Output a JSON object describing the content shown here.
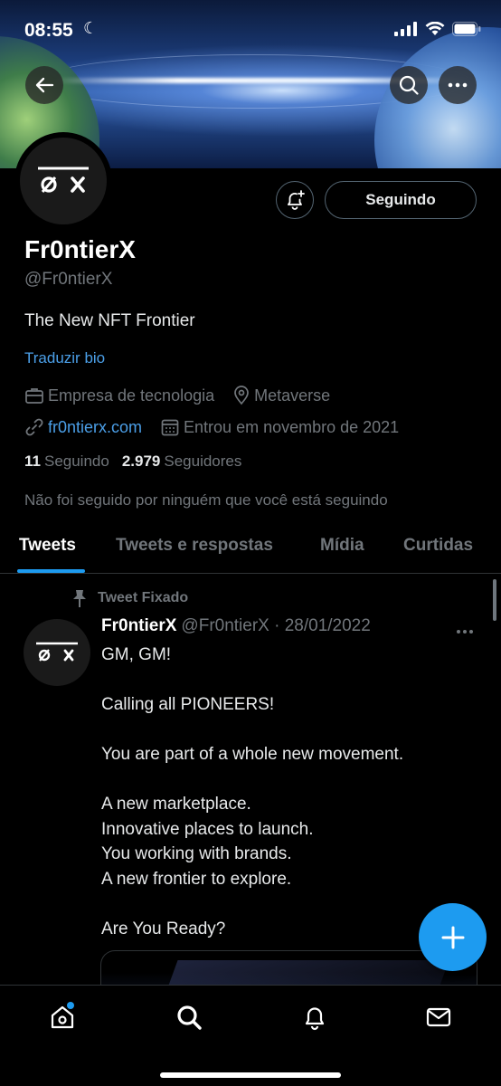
{
  "status_bar": {
    "time": "08:55"
  },
  "profile": {
    "name": "Fr0ntierX",
    "handle": "@Fr0ntierX",
    "bio": "The New NFT Frontier",
    "translate_bio": "Traduzir bio",
    "category": "Empresa de tecnologia",
    "location": "Metaverse",
    "website": "fr0ntierx.com",
    "joined": "Entrou em novembro de 2021",
    "following_count": "11",
    "following_label": "Seguindo",
    "followers_count": "2.979",
    "followers_label": "Seguidores",
    "not_followed_text": "Não foi seguido por ninguém que você está seguindo",
    "follow_button": "Seguindo",
    "avatar_text": "Ø ✕"
  },
  "tabs": [
    {
      "label": "Tweets",
      "active": true
    },
    {
      "label": "Tweets e respostas",
      "active": false
    },
    {
      "label": "Mídia",
      "active": false
    },
    {
      "label": "Curtidas",
      "active": false
    }
  ],
  "tweet": {
    "pinned_label": "Tweet Fixado",
    "author": "Fr0ntierX",
    "handle_date": "@Fr0ntierX · 28/01/2022",
    "text": "GM, GM!\n\nCalling all PIONEERS!\n\nYou are part of a whole new movement.\n\nA new marketplace.\nInnovative places to launch.\nYou working with brands.\nA new frontier to explore.\n\nAre You Ready?"
  },
  "colors": {
    "accent": "#1d9bf0",
    "link": "#4b9fe8",
    "muted": "#71767b",
    "background": "#000000"
  },
  "icons": [
    "back-arrow-icon",
    "search-icon",
    "more-icon",
    "bell-plus-icon",
    "briefcase-icon",
    "location-pin-icon",
    "link-icon",
    "calendar-icon",
    "pin-icon",
    "compose-icon",
    "home-icon",
    "search-nav-icon",
    "notifications-icon",
    "messages-icon"
  ]
}
